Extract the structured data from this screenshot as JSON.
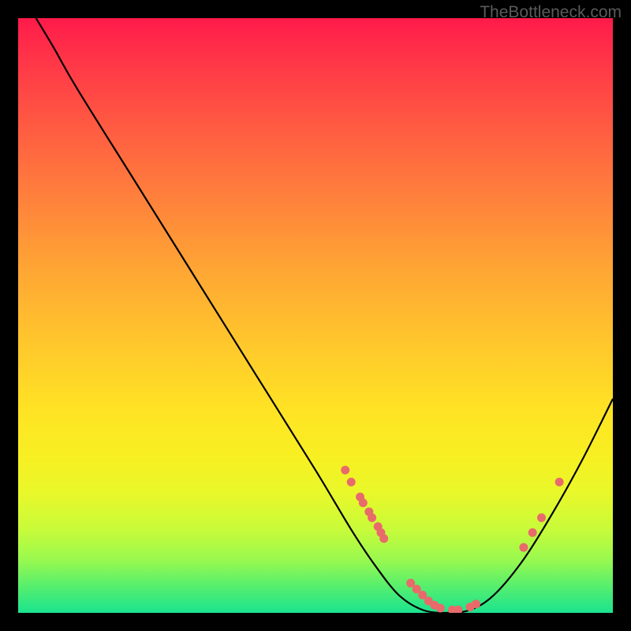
{
  "watermark": "TheBottleneck.com",
  "chart_data": {
    "type": "line",
    "title": "",
    "xlabel": "",
    "ylabel": "",
    "xlim": [
      0,
      100
    ],
    "ylim": [
      0,
      100
    ],
    "grid": false,
    "legend": false,
    "curve": {
      "description": "Bottleneck curve — high at left, dips to minimum around x≈72, rises again",
      "points": [
        {
          "x": 3,
          "y": 100
        },
        {
          "x": 6,
          "y": 95
        },
        {
          "x": 10,
          "y": 88
        },
        {
          "x": 20,
          "y": 72
        },
        {
          "x": 30,
          "y": 56
        },
        {
          "x": 40,
          "y": 40
        },
        {
          "x": 50,
          "y": 24
        },
        {
          "x": 56,
          "y": 14
        },
        {
          "x": 60,
          "y": 8
        },
        {
          "x": 64,
          "y": 3
        },
        {
          "x": 68,
          "y": 0.5
        },
        {
          "x": 72,
          "y": 0
        },
        {
          "x": 76,
          "y": 0.5
        },
        {
          "x": 80,
          "y": 3
        },
        {
          "x": 85,
          "y": 9
        },
        {
          "x": 90,
          "y": 17
        },
        {
          "x": 95,
          "y": 26
        },
        {
          "x": 100,
          "y": 36
        }
      ]
    },
    "markers": {
      "color": "#e96a6a",
      "points": [
        {
          "x": 55,
          "y": 24
        },
        {
          "x": 56,
          "y": 22
        },
        {
          "x": 57.5,
          "y": 19.5
        },
        {
          "x": 58,
          "y": 18.5
        },
        {
          "x": 59,
          "y": 17
        },
        {
          "x": 59.5,
          "y": 16
        },
        {
          "x": 60.5,
          "y": 14.5
        },
        {
          "x": 61,
          "y": 13.5
        },
        {
          "x": 61.5,
          "y": 12.5
        },
        {
          "x": 66,
          "y": 5
        },
        {
          "x": 67,
          "y": 4
        },
        {
          "x": 68,
          "y": 3
        },
        {
          "x": 69,
          "y": 2
        },
        {
          "x": 70,
          "y": 1.3
        },
        {
          "x": 71,
          "y": 0.8
        },
        {
          "x": 73,
          "y": 0.5
        },
        {
          "x": 74,
          "y": 0.5
        },
        {
          "x": 76,
          "y": 1
        },
        {
          "x": 77,
          "y": 1.5
        },
        {
          "x": 85,
          "y": 11
        },
        {
          "x": 86.5,
          "y": 13.5
        },
        {
          "x": 88,
          "y": 16
        },
        {
          "x": 91,
          "y": 22
        }
      ]
    }
  }
}
